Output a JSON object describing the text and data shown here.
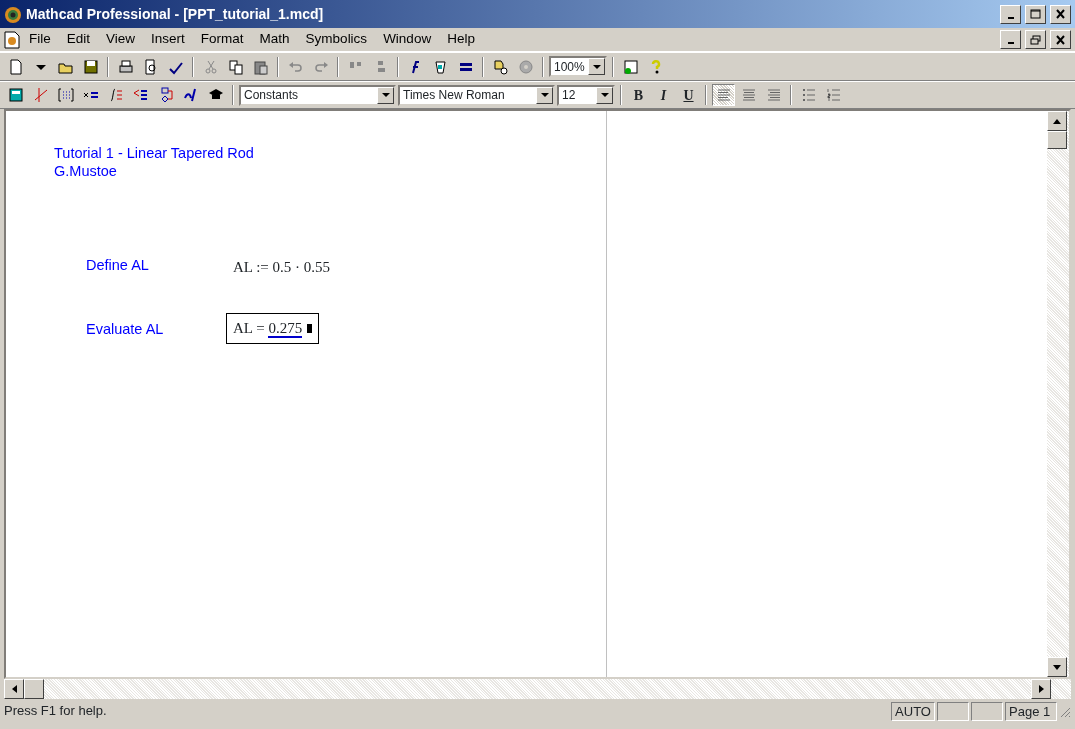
{
  "window": {
    "title": "Mathcad Professional - [PPT_tutorial_1.mcd]"
  },
  "menu": [
    "File",
    "Edit",
    "View",
    "Insert",
    "Format",
    "Math",
    "Symbolics",
    "Window",
    "Help"
  ],
  "toolbar": {
    "zoom": "100%"
  },
  "format_bar": {
    "style": "Constants",
    "font": "Times New Roman",
    "size": "12",
    "styles": [
      {
        "label": "B",
        "kind": "bold"
      },
      {
        "label": "I",
        "kind": "italic"
      },
      {
        "label": "U",
        "kind": "underline"
      }
    ],
    "alignments": [
      {
        "kind": "left",
        "selected": true
      },
      {
        "kind": "center",
        "selected": false
      },
      {
        "kind": "right",
        "selected": false
      }
    ]
  },
  "worksheet": {
    "header": [
      "Tutorial 1 - Linear Tapered Rod",
      "G.Mustoe"
    ],
    "rows": [
      {
        "label": "Define AL",
        "math": {
          "kind": "definition",
          "lhs": "AL",
          "op": ":=",
          "rhs": "0.5 · 0.55",
          "selected": false
        }
      },
      {
        "label": "Evaluate AL",
        "math": {
          "kind": "evaluation",
          "lhs": "AL",
          "op": "=",
          "rhs": "0.275",
          "selected": true
        }
      }
    ]
  },
  "status_bar": {
    "help": "Press F1 for help.",
    "mode": "AUTO",
    "page": "Page 1"
  }
}
